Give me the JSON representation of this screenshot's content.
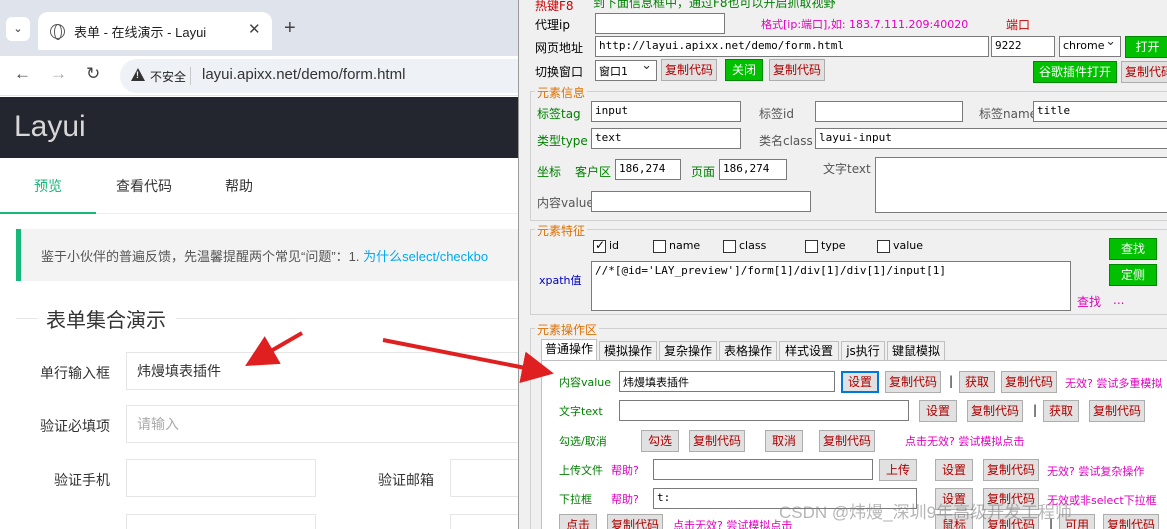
{
  "browser": {
    "tab_title": "表单 - 在线演示 - Layui",
    "insecure_label": "不安全",
    "url": "layui.apixx.net/demo/form.html",
    "logo": "Layui",
    "page_tabs": [
      "预览",
      "查看代码",
      "帮助"
    ],
    "notice_text": "鉴于小伙伴的普遍反馈，先温馨提醒两个常见“问题”：1. ",
    "notice_link": "为什么select/checkbo",
    "legend": "表单集合演示",
    "fields": {
      "single_label": "单行输入框",
      "single_value": "炜熳填表插件",
      "required_label": "验证必填项",
      "required_placeholder": "请输入",
      "phone_label": "验证手机",
      "email_label": "验证邮箱"
    }
  },
  "tool": {
    "top_banner": "热键F8",
    "top_banner_note": "到下面信息框中，通过F8也可以开启抓取视野",
    "proxy_label": "代理ip",
    "proxy_format": "格式[ip:端口],如: 183.7.111.209:40020",
    "port_label": "端口",
    "url_label": "网页地址",
    "url_value": "http://layui.apixx.net/demo/form.html",
    "port_value": "9222",
    "browser_select": "chrome",
    "open_button": "打开",
    "switch_label": "切换窗口",
    "window_select": "窗口1",
    "copy_code": "复制代码",
    "close_button": "关闭",
    "google_plugin_button": "谷歌插件打开",
    "element_info_title": "元素信息",
    "tag_label": "标签tag",
    "tag_value": "input",
    "id_label": "标签id",
    "id_value": "",
    "name_label": "标签name",
    "name_value": "title",
    "type_label": "类型type",
    "type_value": "text",
    "class_label": "类名class",
    "class_value": "layui-input",
    "coord_label": "坐标",
    "client_label": "客户区",
    "client_value": "186,274",
    "page_label": "页面",
    "page_value": "186,274",
    "text_label": "文字text",
    "content_label": "内容value",
    "feature_title": "元素特征",
    "feature_checks": [
      {
        "label": "id",
        "checked": true
      },
      {
        "label": "name",
        "checked": false
      },
      {
        "label": "class",
        "checked": false
      },
      {
        "label": "type",
        "checked": false
      },
      {
        "label": "value",
        "checked": false
      }
    ],
    "xpath_label": "xpath值",
    "xpath_value": "//*[@id='LAY_preview']/form[1]/div[1]/div[1]/input[1]",
    "find_button": "查找",
    "locate_button": "定侧",
    "find_link": "查找",
    "find_dots": "...",
    "op_title": "元素操作区",
    "op_tabs": [
      "普通操作",
      "模拟操作",
      "复杂操作",
      "表格操作",
      "样式设置",
      "js执行",
      "键鼠模拟"
    ],
    "content_value_label": "内容value",
    "content_value": "炜熳填表插件",
    "set_button": "设置",
    "get_button": "获取",
    "multi_hint": "无效? 尝试多重模拟",
    "text_row_label": "文字text",
    "check_label": "勾选/取消",
    "check_button": "勾选",
    "cancel_button": "取消",
    "click_hint": "点击无效? 尝试模拟点击",
    "upload_label": "上传文件",
    "help_label": "帮助?",
    "upload_button": "上传",
    "complex_hint": "无效? 尝试复杂操作",
    "dropdown_label": "下拉框",
    "dropdown_value": "t:",
    "select_hint": "无效或非select下拉框",
    "click_button": "点击",
    "sim_click_hint": "点击无效? 尝试模拟点击",
    "mouse_button": "鼠标",
    "available_button": "可用",
    "bottom_sep": "|",
    "watermark": "CSDN @炜熳_深圳9年高级开发工程师"
  },
  "colors": {
    "layui_green": "#16b777",
    "tool_button_green": "#00c000",
    "arrow_red": "#e02020"
  }
}
